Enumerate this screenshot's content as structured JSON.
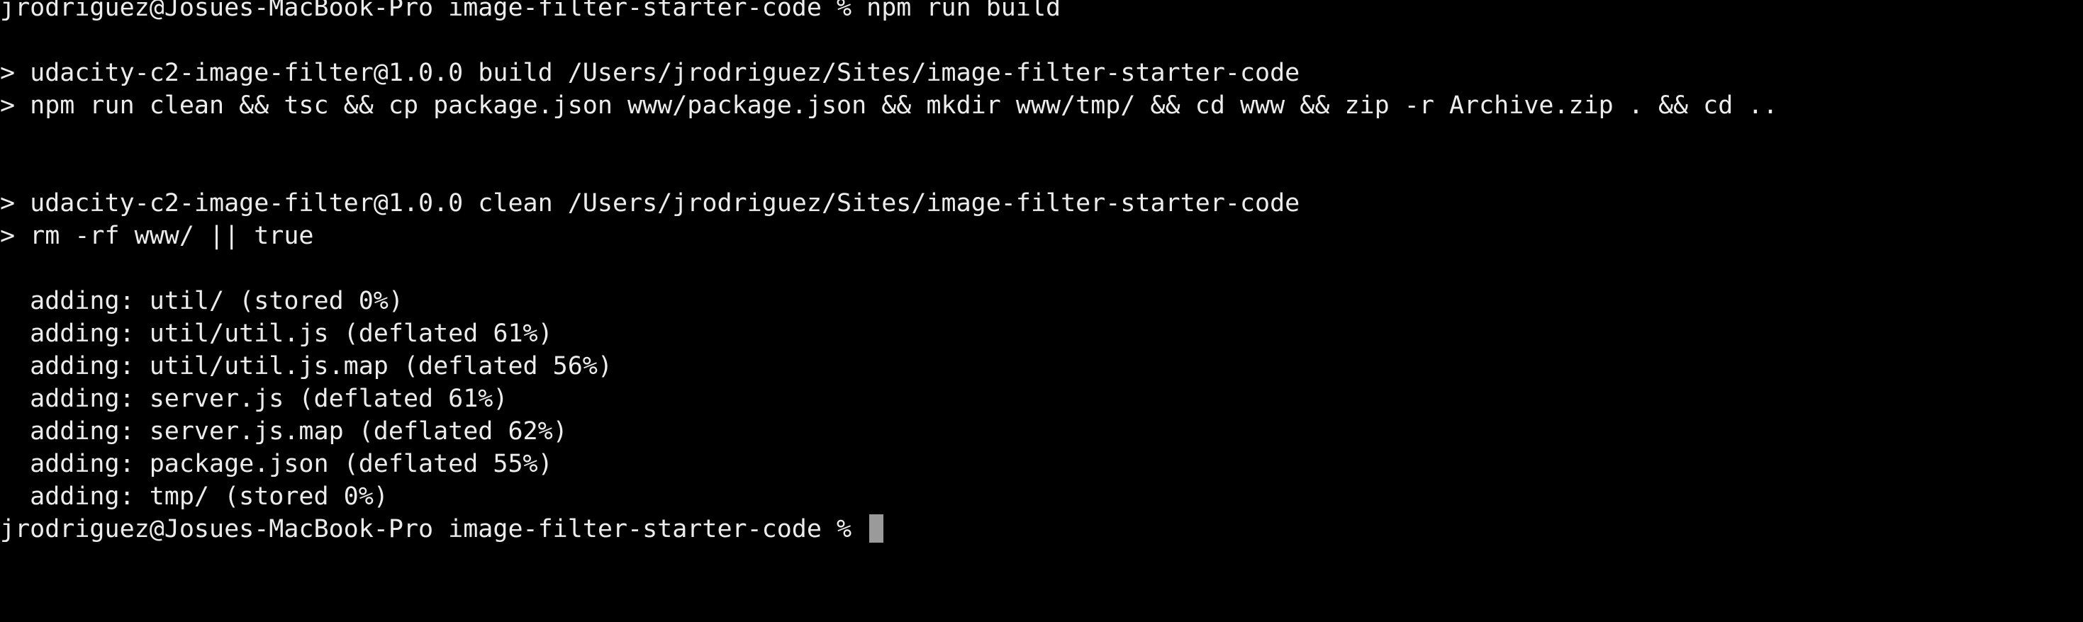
{
  "terminal": {
    "colors": {
      "background": "#000000",
      "foreground": "#ECECEC",
      "cursor": "#9A9A9A"
    },
    "lines": [
      "jrodriguez@Josues-MacBook-Pro image-filter-starter-code % npm run build",
      "",
      "> udacity-c2-image-filter@1.0.0 build /Users/jrodriguez/Sites/image-filter-starter-code",
      "> npm run clean && tsc && cp package.json www/package.json && mkdir www/tmp/ && cd www && zip -r Archive.zip . && cd ..",
      "",
      "",
      "> udacity-c2-image-filter@1.0.0 clean /Users/jrodriguez/Sites/image-filter-starter-code",
      "> rm -rf www/ || true",
      "",
      "  adding: util/ (stored 0%)",
      "  adding: util/util.js (deflated 61%)",
      "  adding: util/util.js.map (deflated 56%)",
      "  adding: server.js (deflated 61%)",
      "  adding: server.js.map (deflated 62%)",
      "  adding: package.json (deflated 55%)",
      "  adding: tmp/ (stored 0%)"
    ],
    "prompt": "jrodriguez@Josues-MacBook-Pro image-filter-starter-code % "
  }
}
